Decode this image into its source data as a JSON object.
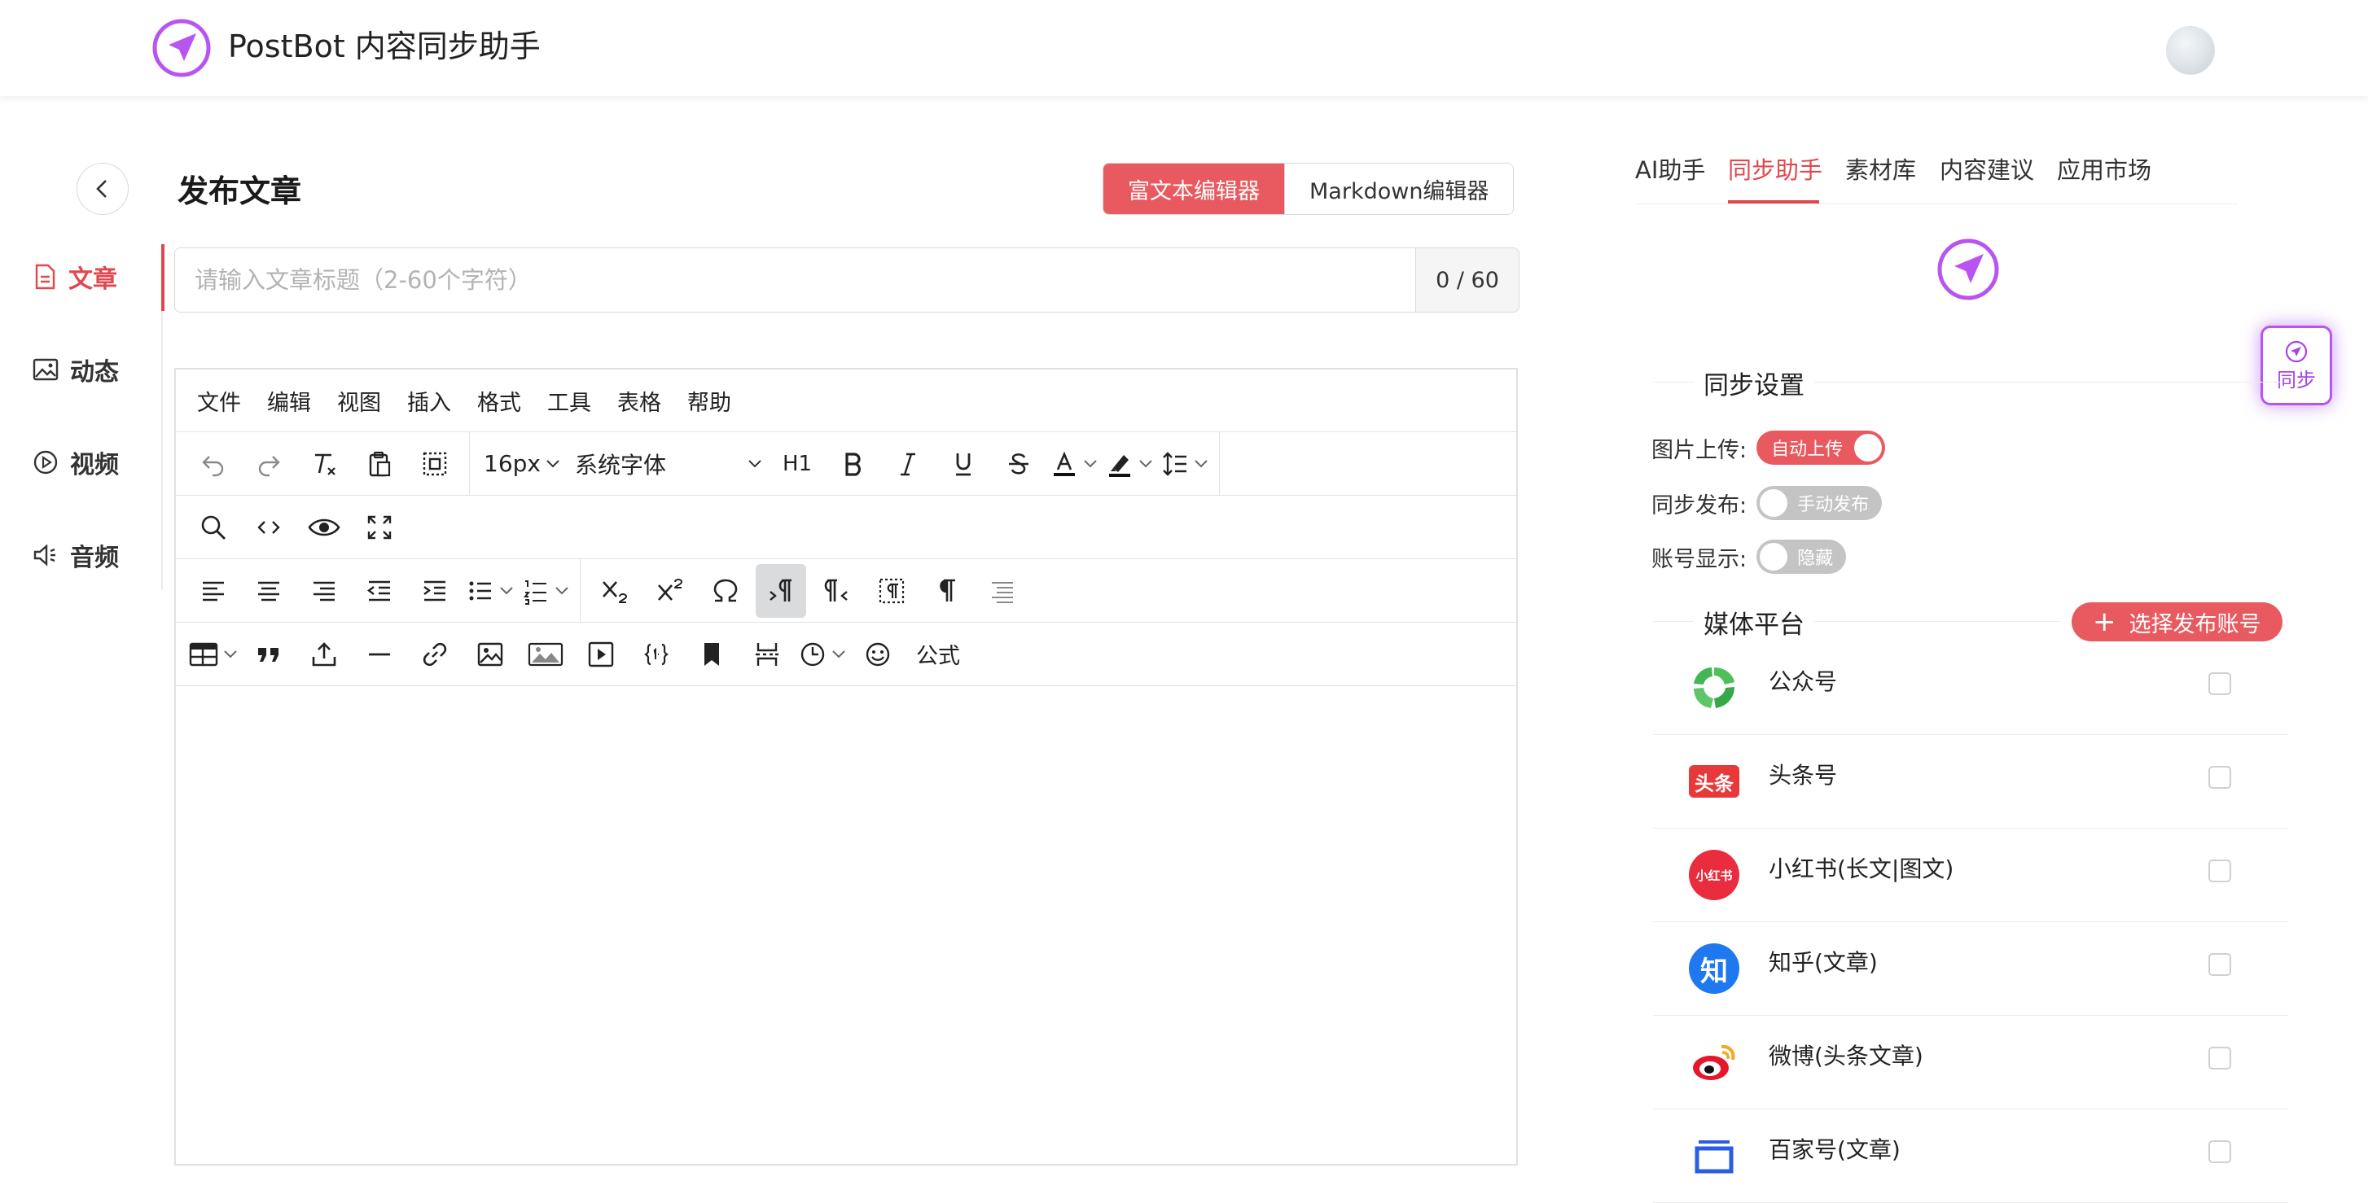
{
  "header": {
    "app_title": "PostBot 内容同步助手"
  },
  "sidebar": {
    "items": [
      {
        "label": "文章",
        "icon": "document-icon",
        "active": true
      },
      {
        "label": "动态",
        "icon": "image-icon",
        "active": false
      },
      {
        "label": "视频",
        "icon": "play-circle-icon",
        "active": false
      },
      {
        "label": "音频",
        "icon": "speaker-icon",
        "active": false
      }
    ]
  },
  "editor_page": {
    "title": "发布文章",
    "mode_options": [
      "富文本编辑器",
      "Markdown编辑器"
    ],
    "active_mode": "富文本编辑器",
    "title_input": {
      "placeholder": "请输入文章标题（2-60个字符）",
      "value": "",
      "count": "0 / 60"
    }
  },
  "editor": {
    "menubar": [
      "文件",
      "编辑",
      "视图",
      "插入",
      "格式",
      "工具",
      "表格",
      "帮助"
    ],
    "font_size": "16px",
    "font_family": "系统字体",
    "heading": "H1",
    "formula_label": "公式"
  },
  "right_panel": {
    "tabs": [
      "AI助手",
      "同步助手",
      "素材库",
      "内容建议",
      "应用市场"
    ],
    "active_tab": "同步助手",
    "sync_settings_title": "同步设置",
    "settings": [
      {
        "label": "图片上传:",
        "state": "自动上传",
        "on": true
      },
      {
        "label": "同步发布:",
        "state": "手动发布",
        "on": false
      },
      {
        "label": "账号显示:",
        "state": "隐藏",
        "on": false
      }
    ],
    "media_title": "媒体平台",
    "select_button": "选择发布账号",
    "platforms": [
      {
        "name": "公众号",
        "icon": "wechat-official-icon"
      },
      {
        "name": "头条号",
        "icon": "toutiao-icon",
        "badge": "头条"
      },
      {
        "name": "小红书(长文|图文)",
        "icon": "xiaohongshu-icon",
        "badge": "小红书"
      },
      {
        "name": "知乎(文章)",
        "icon": "zhihu-icon",
        "badge": "知"
      },
      {
        "name": "微博(头条文章)",
        "icon": "weibo-icon"
      },
      {
        "name": "百家号(文章)",
        "icon": "baijiahao-icon"
      }
    ]
  },
  "float_button": {
    "label": "同步"
  },
  "colors": {
    "accent": "#e85a5f",
    "brand_purple": "#b855f0"
  }
}
